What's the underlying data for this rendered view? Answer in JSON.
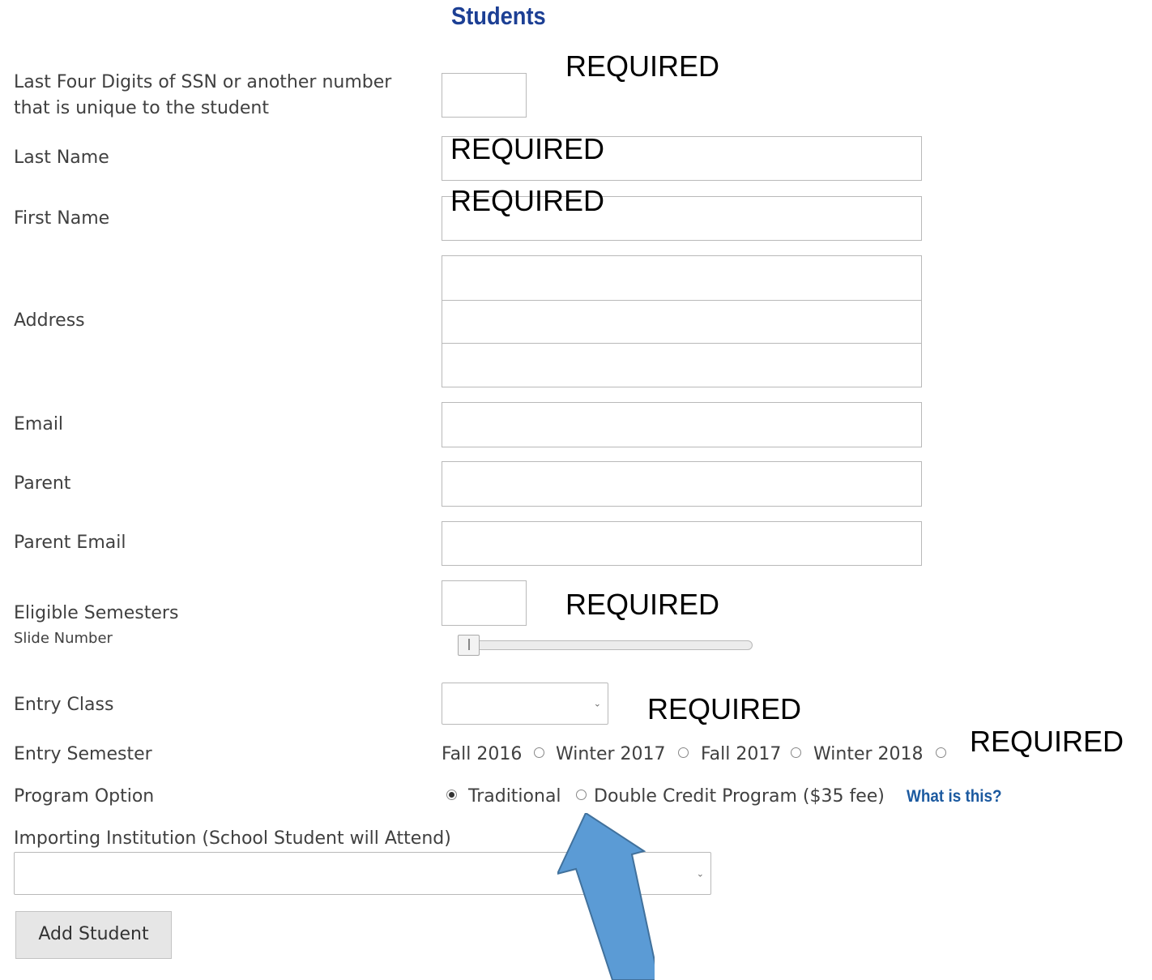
{
  "title": "Students",
  "required_label": "REQUIRED",
  "fields": {
    "ssn_label_line1": "Last Four Digits of SSN or another number",
    "ssn_label_line2": "that is unique to the student",
    "last_name_label": "Last Name",
    "first_name_label": "First Name",
    "address_label": "Address",
    "email_label": "Email",
    "parent_label": "Parent",
    "parent_email_label": "Parent Email",
    "eligible_semesters_label": "Eligible Semesters",
    "slide_number_label": "Slide Number",
    "entry_class_label": "Entry Class",
    "entry_semester_label": "Entry Semester",
    "program_option_label": "Program Option",
    "importing_institution_label": "Importing Institution (School Student will Attend)"
  },
  "slider": {
    "value": 0
  },
  "entry_semesters": [
    "Fall 2016",
    "Winter 2017",
    "Fall 2017",
    "Winter 2018"
  ],
  "program_options": {
    "traditional": "Traditional",
    "double_credit": "Double Credit Program ($35 fee)",
    "what_is_this": "What is this?"
  },
  "add_student_button": "Add Student",
  "colors": {
    "title": "#1c3f94",
    "link": "#1c5aa0",
    "arrow": "#5b9bd5",
    "arrow_border": "#41719c"
  }
}
